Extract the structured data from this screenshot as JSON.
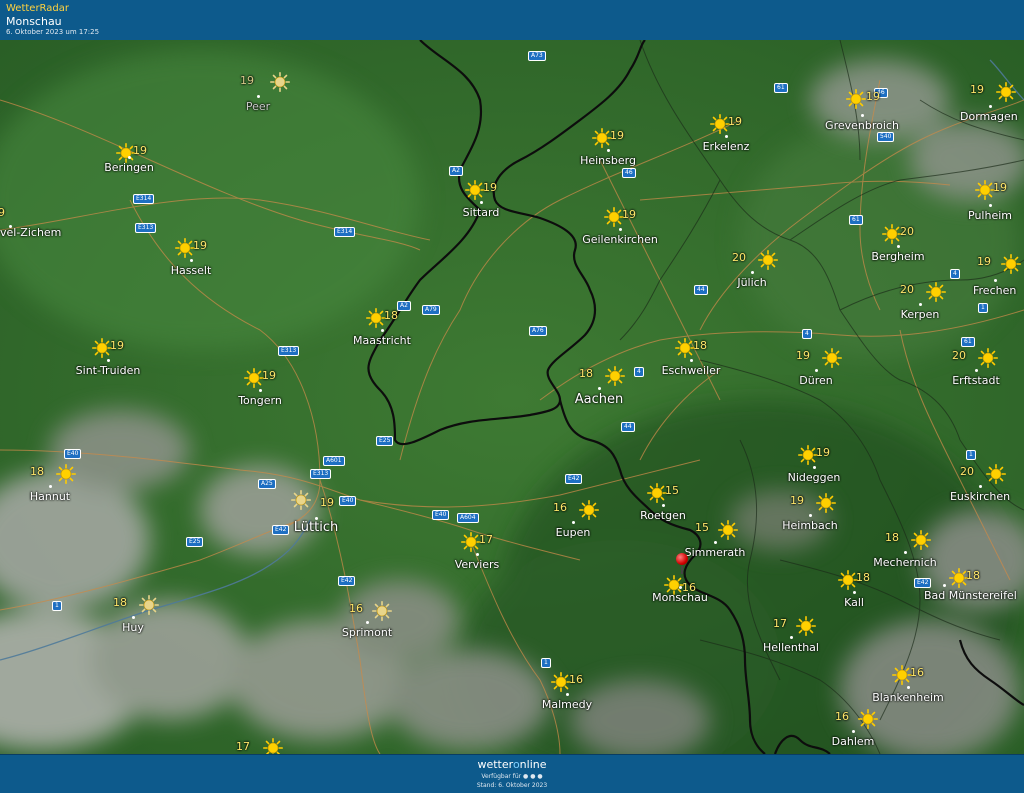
{
  "header": {
    "brand": "WetterRadar",
    "place": "Monschau",
    "date": "6. Oktober 2023 um 17:25"
  },
  "footer": {
    "logo_pre": "wetter",
    "logo_o": "o",
    "logo_post": "nline",
    "available": "Verfügbar für",
    "stand": "Stand: 6. Oktober 2023"
  },
  "colors": {
    "header_bg": "#0d5a8c",
    "map_green": "#2f6a2a",
    "temp_text": "#ffe76a",
    "road_badge": "#1e6fc2",
    "border": "#111111"
  },
  "cities": [
    {
      "name": "Peer",
      "temp": "19",
      "dim": true
    },
    {
      "name": "Beringen",
      "temp": "19"
    },
    {
      "name": "Heinsberg",
      "temp": "19"
    },
    {
      "name": "Erkelenz",
      "temp": "19"
    },
    {
      "name": "Grevenbroich",
      "temp": "19"
    },
    {
      "name": "Dormagen",
      "temp": "19"
    },
    {
      "name": "Sittard",
      "temp": "19"
    },
    {
      "name": "vel-Zichem",
      "temp": "9"
    },
    {
      "name": "Geilenkirchen",
      "temp": "19"
    },
    {
      "name": "Pulheim",
      "temp": "19"
    },
    {
      "name": "Hasselt",
      "temp": "19"
    },
    {
      "name": "Jülich",
      "temp": "20"
    },
    {
      "name": "Bergheim",
      "temp": "20"
    },
    {
      "name": "Frechen",
      "temp": "19"
    },
    {
      "name": "Maastricht",
      "temp": "18"
    },
    {
      "name": "Kerpen",
      "temp": "20"
    },
    {
      "name": "Sint-Truiden",
      "temp": "19"
    },
    {
      "name": "Eschweiler",
      "temp": "18"
    },
    {
      "name": "Düren",
      "temp": "19"
    },
    {
      "name": "Erftstadt",
      "temp": "20"
    },
    {
      "name": "Tongern",
      "temp": "19"
    },
    {
      "name": "Aachen",
      "temp": "18",
      "big": true
    },
    {
      "name": "Nideggen",
      "temp": "19"
    },
    {
      "name": "Hannut",
      "temp": "18"
    },
    {
      "name": "Euskirchen",
      "temp": "20"
    },
    {
      "name": "Lüttich",
      "temp": "19",
      "big": true
    },
    {
      "name": "Roetgen",
      "temp": "15"
    },
    {
      "name": "Heimbach",
      "temp": "19"
    },
    {
      "name": "Eupen",
      "temp": "16"
    },
    {
      "name": "Simmerath",
      "temp": "15"
    },
    {
      "name": "Verviers",
      "temp": "17"
    },
    {
      "name": "Mechernich",
      "temp": "18"
    },
    {
      "name": "Monschau",
      "temp": "16"
    },
    {
      "name": "Kall",
      "temp": "18"
    },
    {
      "name": "Bad Münstereifel",
      "temp": "18"
    },
    {
      "name": "Huy",
      "temp": "18"
    },
    {
      "name": "Sprimont",
      "temp": "16"
    },
    {
      "name": "Hellenthal",
      "temp": "17"
    },
    {
      "name": "Malmedy",
      "temp": "16"
    },
    {
      "name": "Blankenheim",
      "temp": "16"
    },
    {
      "name": "Dahlem",
      "temp": "16"
    },
    {
      "name": "",
      "temp": "17"
    }
  ],
  "roads": [
    "A73",
    "61",
    "46",
    "540",
    "A2",
    "46",
    "E314",
    "E313",
    "E314",
    "61",
    "4",
    "A2",
    "A79",
    "A76",
    "44",
    "1",
    "4",
    "61",
    "E313",
    "4",
    "E25",
    "44",
    "A601",
    "E313",
    "E40",
    "A25",
    "E40",
    "E40",
    "E42",
    "A604",
    "E42",
    "E25",
    "E42",
    "1",
    "1",
    "E42",
    "1"
  ]
}
